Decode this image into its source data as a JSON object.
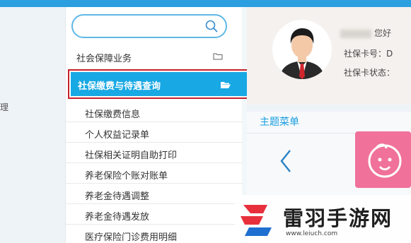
{
  "left_gutter": {
    "edge_text": "理"
  },
  "search": {
    "placeholder": ""
  },
  "section": {
    "label": "社会保障业务"
  },
  "active_item": {
    "label": "社保缴费与待遇查询"
  },
  "submenu": {
    "items": [
      "社保缴费信息",
      "个人权益记录单",
      "社保相关证明自助打印",
      "养老保险个账对账单",
      "养老金待遇调整",
      "养老金待遇发放",
      "医疗保险门诊费用明细"
    ]
  },
  "profile": {
    "greeting": "您好",
    "card_no_label": "社保卡号：D",
    "card_status_label": "社保卡状态："
  },
  "theme_menu": {
    "title": "主题菜单"
  },
  "watermark": {
    "title": "雷羽手游网",
    "url": "www.leiuch.com"
  },
  "colors": {
    "accent": "#18a8e4",
    "highlight_border": "#c5222b",
    "tile": "#f0719a"
  },
  "icons": [
    "search-icon",
    "folder-icon",
    "folder-open-icon",
    "avatar-icon",
    "chevron-left-icon",
    "baby-face-icon"
  ]
}
